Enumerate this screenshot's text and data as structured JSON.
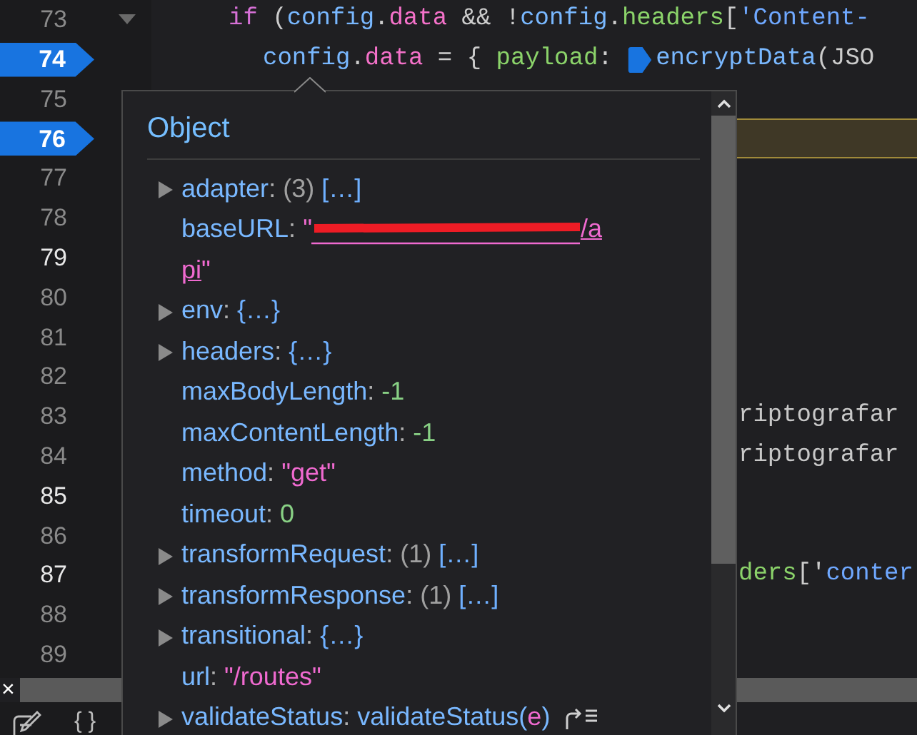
{
  "gutter": {
    "lines": [
      {
        "number": "73",
        "breakpoint": false,
        "current": false,
        "bright": false,
        "fold": true,
        "kind": "full",
        "tokens": [
          {
            "t": "if",
            "kind": "keyword"
          },
          {
            "t": " (",
            "kind": "punct"
          },
          {
            "t": "config",
            "kind": "var"
          },
          {
            "t": ".",
            "kind": "punct"
          },
          {
            "t": "data",
            "kind": "prop"
          },
          {
            "t": " && !",
            "kind": "punct"
          },
          {
            "t": "config",
            "kind": "var"
          },
          {
            "t": ".",
            "kind": "punct"
          },
          {
            "t": "headers",
            "kind": "field"
          },
          {
            "t": "[",
            "kind": "punct"
          },
          {
            "t": "'Content-",
            "kind": "str"
          }
        ]
      },
      {
        "number": "74",
        "breakpoint": true,
        "current": false,
        "kind": "indented",
        "tokens": [
          {
            "t": "config",
            "kind": "var"
          },
          {
            "t": ".",
            "kind": "punct"
          },
          {
            "t": "data",
            "kind": "prop"
          },
          {
            "t": " = { ",
            "kind": "punct"
          },
          {
            "t": "payload",
            "kind": "field"
          },
          {
            "t": ": ",
            "kind": "punct"
          },
          {
            "kind": "marker"
          },
          {
            "t": "encryptData",
            "kind": "var"
          },
          {
            "t": "(JSO",
            "kind": "punct"
          }
        ]
      },
      {
        "number": "75",
        "breakpoint": false,
        "current": false,
        "bright": false,
        "kind": "tail"
      },
      {
        "number": "76",
        "breakpoint": true,
        "current": true,
        "kind": "tail"
      },
      {
        "number": "77",
        "breakpoint": false,
        "current": false,
        "bright": false,
        "kind": "tail"
      },
      {
        "number": "78",
        "breakpoint": false,
        "current": false,
        "bright": false,
        "kind": "tail"
      },
      {
        "number": "79",
        "breakpoint": false,
        "current": false,
        "bright": true,
        "kind": "tail"
      },
      {
        "number": "80",
        "breakpoint": false,
        "current": false,
        "bright": false,
        "kind": "tail"
      },
      {
        "number": "81",
        "breakpoint": false,
        "current": false,
        "bright": false,
        "kind": "tail"
      },
      {
        "number": "82",
        "breakpoint": false,
        "current": false,
        "bright": false,
        "kind": "tail"
      },
      {
        "number": "83",
        "breakpoint": false,
        "current": false,
        "bright": false,
        "kind": "tail",
        "tokens": [
          {
            "t": "riptografar",
            "kind": "comment"
          }
        ]
      },
      {
        "number": "84",
        "breakpoint": false,
        "current": false,
        "bright": false,
        "kind": "tail",
        "tokens": [
          {
            "t": "riptografar",
            "kind": "comment"
          }
        ]
      },
      {
        "number": "85",
        "breakpoint": false,
        "current": false,
        "bright": true,
        "kind": "tail"
      },
      {
        "number": "86",
        "breakpoint": false,
        "current": false,
        "bright": false,
        "kind": "tail"
      },
      {
        "number": "87",
        "breakpoint": false,
        "current": false,
        "bright": true,
        "kind": "tail",
        "tokens": [
          {
            "t": "ders",
            "kind": "field"
          },
          {
            "t": "['",
            "kind": "punct"
          },
          {
            "t": "conter",
            "kind": "str"
          }
        ]
      },
      {
        "number": "88",
        "breakpoint": false,
        "current": false,
        "bright": false,
        "kind": "tail"
      },
      {
        "number": "89",
        "breakpoint": false,
        "current": false,
        "bright": false,
        "kind": "tail"
      }
    ]
  },
  "popup": {
    "title": "Object",
    "properties": [
      {
        "name": "adapter",
        "sep": ":",
        "expandable": true,
        "count": "(3)",
        "value": "[…]",
        "kind": "collapsed"
      },
      {
        "name": "baseURL",
        "sep": ":",
        "expandable": false,
        "open": "\"",
        "value_lines": [
          "/a",
          "pi"
        ],
        "close": "\"",
        "redacted": true,
        "kind": "url"
      },
      {
        "name": "env",
        "sep": ":",
        "expandable": true,
        "value": "{…}",
        "kind": "collapsed"
      },
      {
        "name": "headers",
        "sep": ":",
        "expandable": true,
        "value": "{…}",
        "kind": "collapsed"
      },
      {
        "name": "maxBodyLength",
        "sep": ":",
        "expandable": false,
        "value": "-1",
        "kind": "number"
      },
      {
        "name": "maxContentLength",
        "sep": ":",
        "expandable": false,
        "value": "-1",
        "kind": "number"
      },
      {
        "name": "method",
        "sep": ":",
        "expandable": false,
        "value": "\"get\"",
        "kind": "string"
      },
      {
        "name": "timeout",
        "sep": ":",
        "expandable": false,
        "value": "0",
        "kind": "number"
      },
      {
        "name": "transformRequest",
        "sep": ":",
        "expandable": true,
        "count": "(1)",
        "value": "[…]",
        "kind": "collapsed"
      },
      {
        "name": "transformResponse",
        "sep": ":",
        "expandable": true,
        "count": "(1)",
        "value": "[…]",
        "kind": "collapsed"
      },
      {
        "name": "transitional",
        "sep": ":",
        "expandable": true,
        "value": "{…}",
        "kind": "collapsed"
      },
      {
        "name": "url",
        "sep": ":",
        "expandable": false,
        "value": "\"/routes\"",
        "kind": "string"
      },
      {
        "name": "validateStatus",
        "sep": ":",
        "expandable": true,
        "value": "validateStatus(",
        "param": "e",
        "close": ")",
        "kind": "function"
      }
    ]
  },
  "bottom": {
    "close": "×",
    "braces": "{ }"
  }
}
